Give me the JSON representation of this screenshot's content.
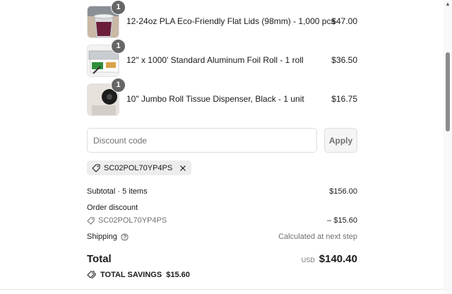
{
  "items": [
    {
      "qty": "1",
      "name": "12-24oz PLA Eco-Friendly Flat Lids (98mm) - 1,000 pcs",
      "price": "$47.00",
      "image": "cup-with-lid-photo"
    },
    {
      "qty": "1",
      "name": "12\" x 1000' Standard Aluminum Foil Roll - 1 roll",
      "price": "$36.50",
      "image": "foil-roll-box-photo"
    },
    {
      "qty": "1",
      "name": "10\" Jumbo Roll Tissue Dispenser, Black - 1 unit",
      "price": "$16.75",
      "image": "tissue-dispenser-photo"
    }
  ],
  "discount": {
    "placeholder": "Discount code",
    "apply_label": "Apply",
    "applied_code": "SC02POL70YP4PS"
  },
  "summary": {
    "subtotal_label": "Subtotal · 5 items",
    "subtotal_value": "$156.00",
    "order_discount_label": "Order discount",
    "discount_code": "SC02POL70YP4PS",
    "discount_value": "– $15.60",
    "shipping_label": "Shipping",
    "shipping_value": "Calculated at next step",
    "total_label": "Total",
    "currency": "USD",
    "total_value": "$140.40",
    "savings_label": "TOTAL SAVINGS",
    "savings_value": "$15.60"
  },
  "colors": {
    "text": "#1a1a1a",
    "muted": "#707070",
    "badge": "#666666",
    "chip": "#ededed"
  }
}
